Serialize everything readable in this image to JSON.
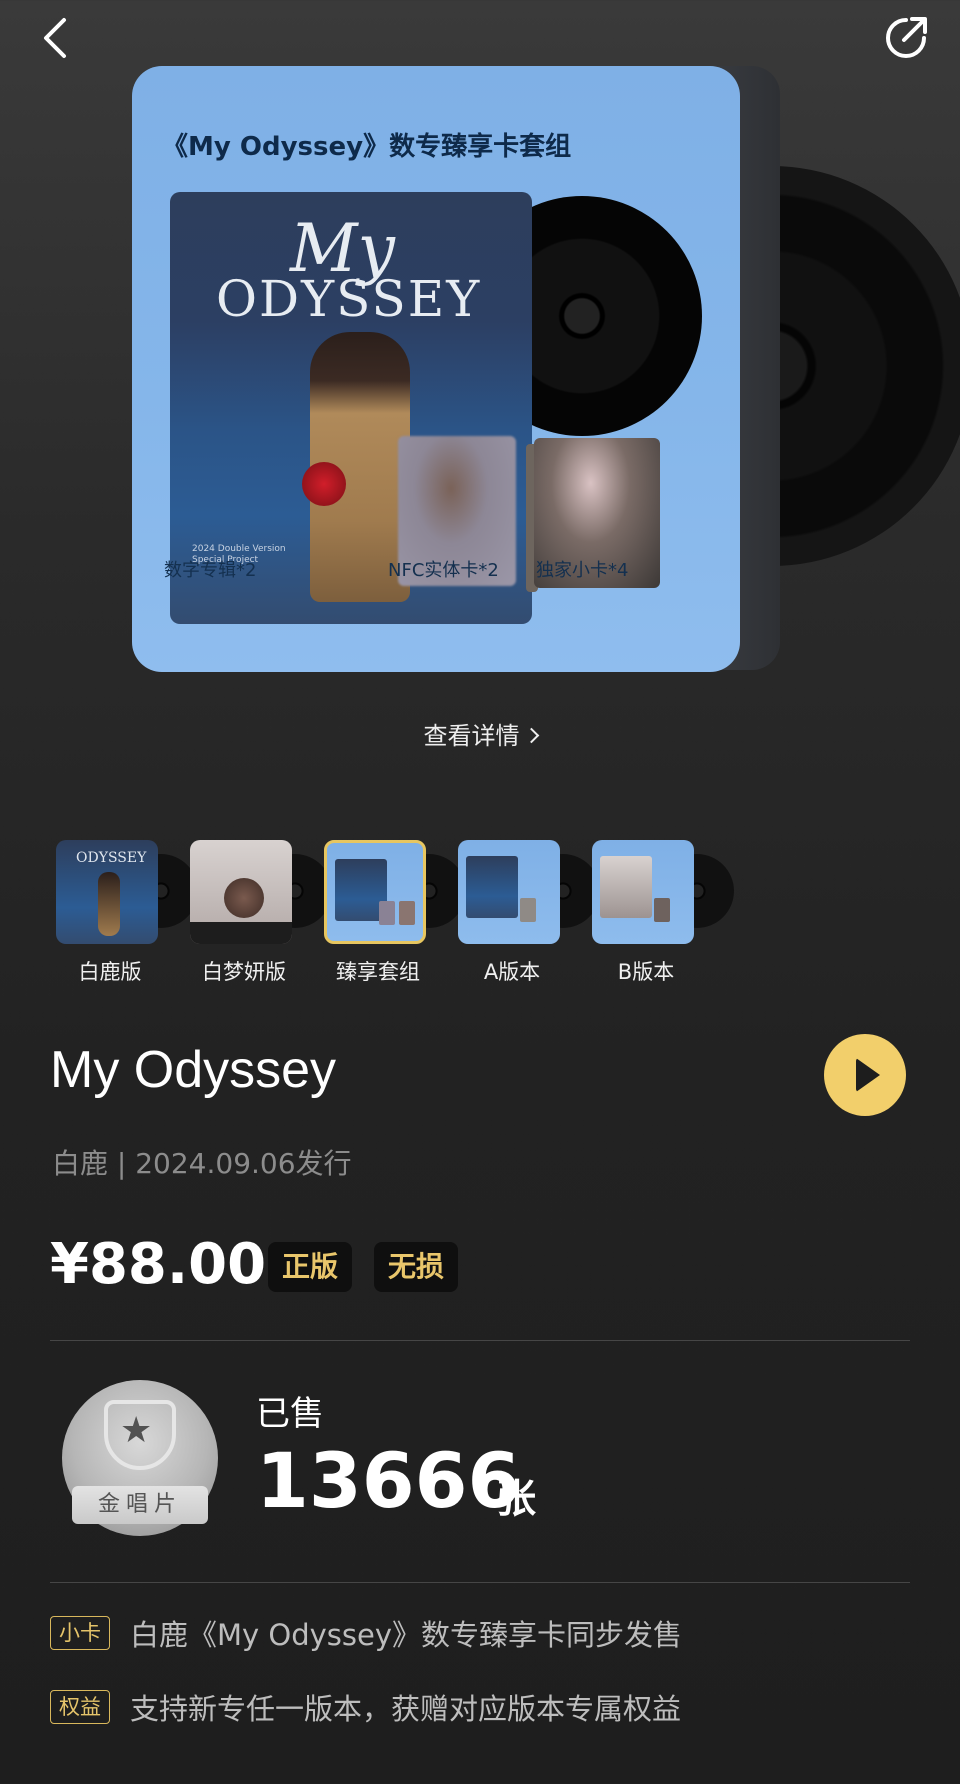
{
  "nav": {
    "back_icon": "chevron-left-icon",
    "share_icon": "share-icon"
  },
  "hero": {
    "title": "《My Odyssey》数专臻享卡套组",
    "cover_line1": "My",
    "cover_line2": "ODYSSEY",
    "cover_sub": "2024 Double Version Special Project",
    "labels": [
      "数字专辑*2",
      "NFC实体卡*2",
      "独家小卡*4"
    ]
  },
  "detail_link": "查看详情",
  "versions": [
    {
      "label": "白鹿版",
      "selected": false
    },
    {
      "label": "白梦妍版",
      "selected": false
    },
    {
      "label": "臻享套组",
      "selected": true
    },
    {
      "label": "A版本",
      "selected": false
    },
    {
      "label": "B版本",
      "selected": false
    }
  ],
  "album": {
    "title": "My Odyssey",
    "artist_line": "白鹿 | 2024.09.06发行",
    "price": "¥88.00",
    "badges": [
      "正版",
      "无损"
    ]
  },
  "sales": {
    "medal_label": "金唱片",
    "sold_label": "已售",
    "sold_count": "13666",
    "sold_unit": "张"
  },
  "info": [
    {
      "tag": "小卡",
      "text": "白鹿《My Odyssey》数专臻享卡同步发售"
    },
    {
      "tag": "权益",
      "text": "支持新专任一版本，获赠对应版本专属权益"
    }
  ],
  "colors": {
    "accent": "#f2cf6b",
    "badge_text": "#e9c66b",
    "hero_bg": "#85b6ea",
    "selected_border": "#e7c660"
  }
}
